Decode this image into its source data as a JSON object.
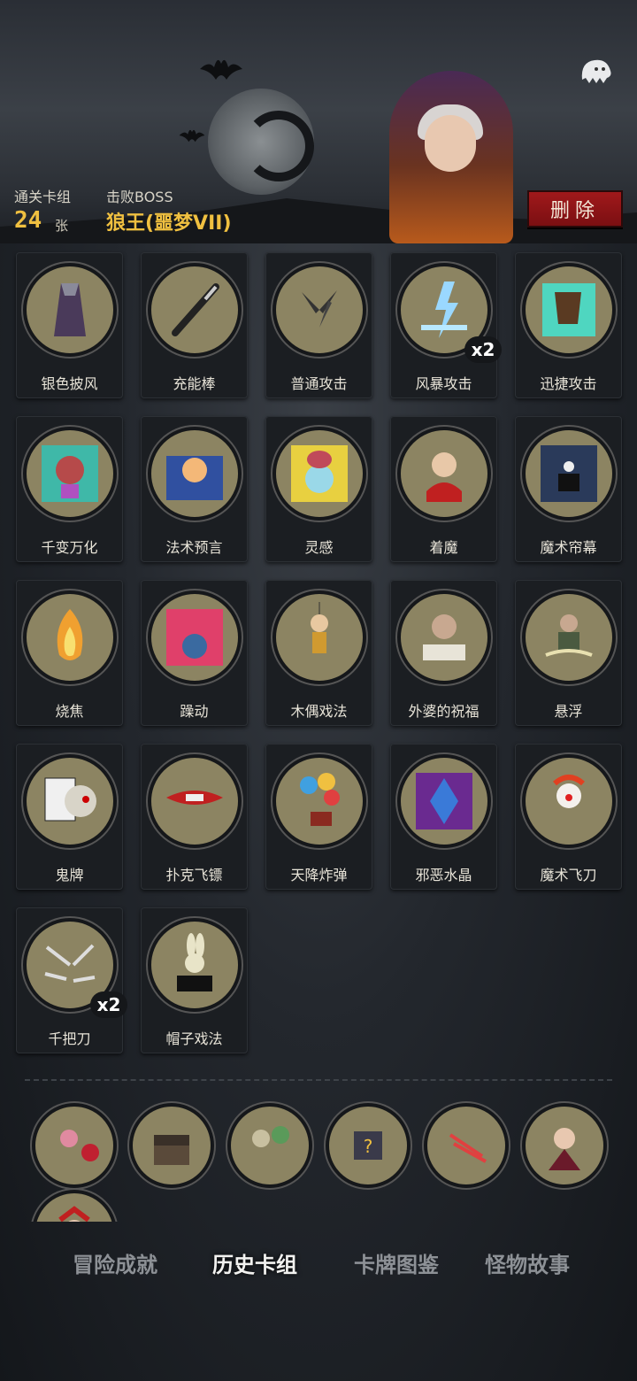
{
  "header": {
    "cleared_label": "通关卡组",
    "cleared_count": "24",
    "cleared_unit": "张",
    "boss_label": "击败BOSS",
    "boss_name": "狼王(噩梦VII)",
    "delete_label": "删除"
  },
  "cards": [
    {
      "name": "银色披风",
      "icon": "cloak-icon",
      "bg": "#8c8462"
    },
    {
      "name": "充能棒",
      "icon": "wand-icon",
      "bg": "#8c8462"
    },
    {
      "name": "普通攻击",
      "icon": "daggers-icon",
      "bg": "#8c8462"
    },
    {
      "name": "风暴攻击",
      "icon": "lightning-icon",
      "bg": "#8c8462",
      "mult": "x2"
    },
    {
      "name": "迅捷攻击",
      "icon": "swift-attack-icon",
      "bg": "#8c8462"
    },
    {
      "name": "千变万化",
      "icon": "shapeshift-icon",
      "bg": "#8c8462"
    },
    {
      "name": "法术预言",
      "icon": "crystal-ball-icon",
      "bg": "#8c8462"
    },
    {
      "name": "灵感",
      "icon": "brain-skull-icon",
      "bg": "#8c8462"
    },
    {
      "name": "着魔",
      "icon": "possessed-icon",
      "bg": "#8c8462"
    },
    {
      "name": "魔术帘幕",
      "icon": "magic-curtain-icon",
      "bg": "#8c8462"
    },
    {
      "name": "烧焦",
      "icon": "fire-icon",
      "bg": "#8c8462"
    },
    {
      "name": "躁动",
      "icon": "frenzy-icon",
      "bg": "#8c8462"
    },
    {
      "name": "木偶戏法",
      "icon": "puppet-icon",
      "bg": "#8c8462"
    },
    {
      "name": "外婆的祝福",
      "icon": "grandma-book-icon",
      "bg": "#8c8462"
    },
    {
      "name": "悬浮",
      "icon": "levitate-icon",
      "bg": "#8c8462"
    },
    {
      "name": "鬼牌",
      "icon": "joker-card-icon",
      "bg": "#8c8462"
    },
    {
      "name": "扑克飞镖",
      "icon": "card-dart-icon",
      "bg": "#8c8462"
    },
    {
      "name": "天降炸弹",
      "icon": "balloon-bomb-icon",
      "bg": "#8c8462"
    },
    {
      "name": "邪恶水晶",
      "icon": "evil-crystal-icon",
      "bg": "#8c8462"
    },
    {
      "name": "魔术飞刀",
      "icon": "clown-knives-icon",
      "bg": "#8c8462"
    },
    {
      "name": "千把刀",
      "icon": "thousand-knives-icon",
      "bg": "#8c8462",
      "mult": "x2"
    },
    {
      "name": "帽子戏法",
      "icon": "rabbit-hat-icon",
      "bg": "#8c8462"
    }
  ],
  "history_decks": [
    {
      "icon": "performers-icon"
    },
    {
      "icon": "treasure-chest-icon"
    },
    {
      "icon": "zombies-icon"
    },
    {
      "icon": "mystery-box-icon"
    },
    {
      "icon": "claw-slash-icon"
    },
    {
      "icon": "vampire-icon"
    },
    {
      "icon": "jester-icon"
    }
  ],
  "tabs": [
    {
      "label": "冒险成就",
      "active": false
    },
    {
      "label": "历史卡组",
      "active": true
    },
    {
      "label": "卡牌图鉴",
      "active": false
    },
    {
      "label": "怪物故事",
      "active": false
    }
  ],
  "colors": {
    "accent_gold": "#f0c040",
    "delete_red": "#a1191b",
    "card_bg": "#1b1e22",
    "art_bg": "#8c8462"
  }
}
